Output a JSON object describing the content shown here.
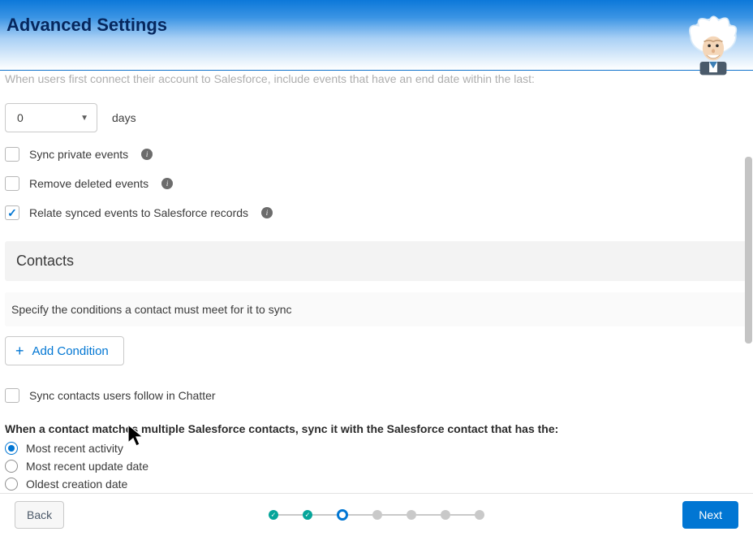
{
  "header": {
    "title": "Advanced Settings"
  },
  "helper_text": "When users first connect their account to Salesforce, include events that have an end date within the last:",
  "days": {
    "value": "0",
    "unit": "days"
  },
  "events": {
    "sync_private": {
      "checked": false,
      "label": "Sync private events"
    },
    "remove_deleted": {
      "checked": false,
      "label": "Remove deleted events"
    },
    "relate_synced": {
      "checked": true,
      "label": "Relate synced events to Salesforce records"
    }
  },
  "contacts": {
    "section_title": "Contacts",
    "instructions": "Specify the conditions a contact must meet for it to sync",
    "add_condition_label": "Add Condition",
    "sync_chatter": {
      "checked": false,
      "label": "Sync contacts users follow in Chatter"
    },
    "match_heading": "When a contact matches multiple Salesforce contacts, sync it with the Salesforce contact that has the:",
    "match_options": [
      {
        "label": "Most recent activity",
        "selected": true
      },
      {
        "label": "Most recent update date",
        "selected": false
      },
      {
        "label": "Oldest creation date",
        "selected": false
      }
    ]
  },
  "footer": {
    "back": "Back",
    "next": "Next",
    "steps": [
      "done",
      "done",
      "current",
      "future",
      "future",
      "future",
      "future"
    ]
  }
}
